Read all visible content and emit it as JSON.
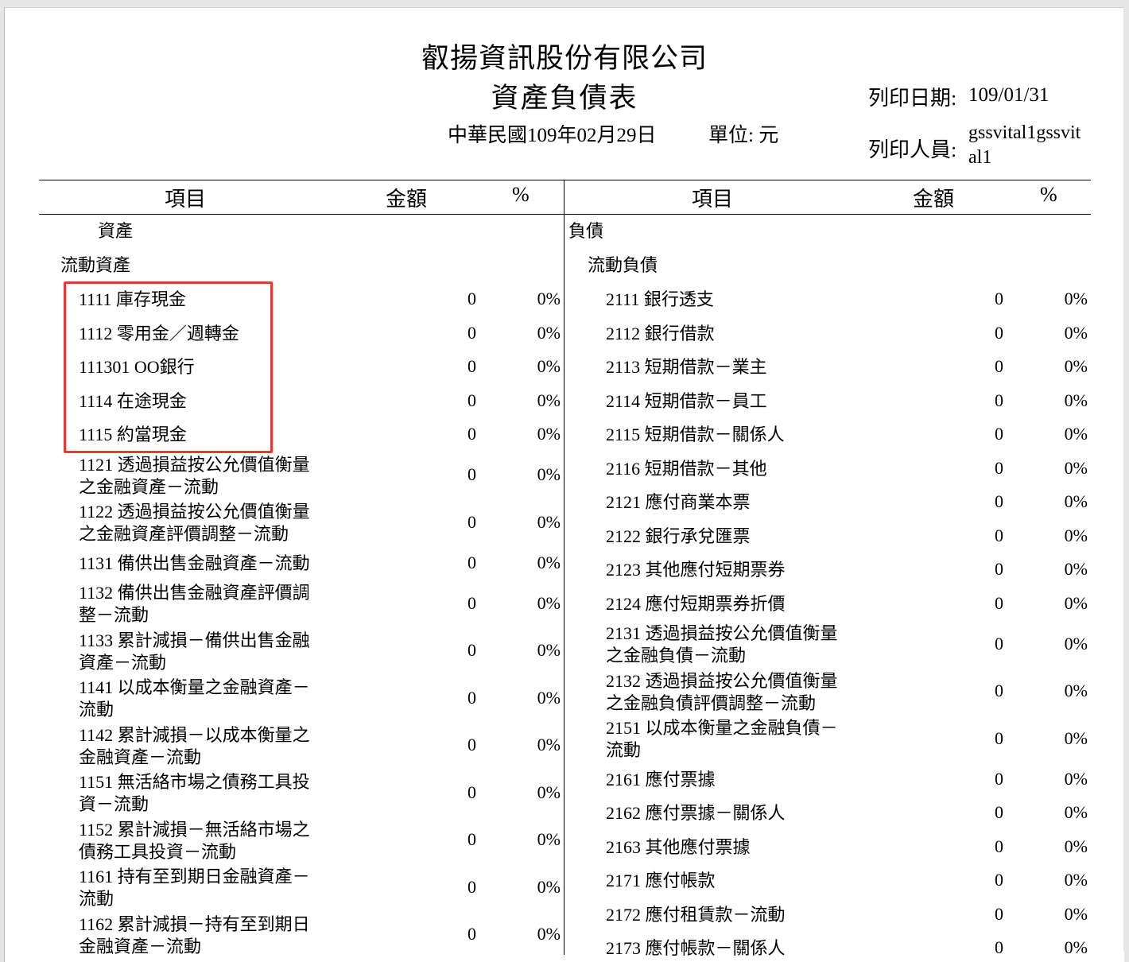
{
  "header": {
    "company": "叡揚資訊股份有限公司",
    "title": "資產負債表",
    "date": "中華民國109年02月29日",
    "unit": "單位: 元",
    "print_date_label": "列印日期:",
    "print_date": "109/01/31",
    "printer_label": "列印人員:",
    "printer": "gssvital1gssvital1"
  },
  "columns": {
    "left": {
      "item": "項目",
      "amount": "金額",
      "pct": "%"
    },
    "right": {
      "item": "項目",
      "amount": "金額",
      "pct": "%"
    }
  },
  "left": {
    "section": "資產",
    "subsection": "流動資產",
    "rows": [
      {
        "lines": [
          "1111 庫存現金"
        ],
        "amount": "0",
        "pct": "0%"
      },
      {
        "lines": [
          "1112 零用金／週轉金"
        ],
        "amount": "0",
        "pct": "0%"
      },
      {
        "lines": [
          "111301 OO銀行"
        ],
        "amount": "0",
        "pct": "0%"
      },
      {
        "lines": [
          "1114 在途現金"
        ],
        "amount": "0",
        "pct": "0%"
      },
      {
        "lines": [
          "1115 約當現金"
        ],
        "amount": "0",
        "pct": "0%"
      },
      {
        "lines": [
          "1121 透過損益按公允價值衡量",
          "之金融資產－流動"
        ],
        "amount": "0",
        "pct": "0%"
      },
      {
        "lines": [
          "1122 透過損益按公允價值衡量",
          "之金融資產評價調整－流動"
        ],
        "amount": "0",
        "pct": "0%"
      },
      {
        "lines": [
          "1131 備供出售金融資產－流動"
        ],
        "amount": "0",
        "pct": "0%"
      },
      {
        "lines": [
          "1132 備供出售金融資產評價調",
          "整－流動"
        ],
        "amount": "0",
        "pct": "0%"
      },
      {
        "lines": [
          "1133 累計減損－備供出售金融",
          "資產－流動"
        ],
        "amount": "0",
        "pct": "0%"
      },
      {
        "lines": [
          "1141 以成本衡量之金融資產－",
          "流動"
        ],
        "amount": "0",
        "pct": "0%"
      },
      {
        "lines": [
          "1142 累計減損－以成本衡量之",
          "金融資產－流動"
        ],
        "amount": "0",
        "pct": "0%"
      },
      {
        "lines": [
          "1151 無活絡市場之債務工具投",
          "資－流動"
        ],
        "amount": "0",
        "pct": "0%"
      },
      {
        "lines": [
          "1152 累計減損－無活絡市場之",
          "債務工具投資－流動"
        ],
        "amount": "0",
        "pct": "0%"
      },
      {
        "lines": [
          "1161 持有至到期日金融資產－",
          "流動"
        ],
        "amount": "0",
        "pct": "0%"
      },
      {
        "lines": [
          "1162 累計減損－持有至到期日",
          "金融資產－流動"
        ],
        "amount": "0",
        "pct": "0%"
      }
    ]
  },
  "right": {
    "section": "負債",
    "subsection": "流動負債",
    "rows": [
      {
        "lines": [
          "2111 銀行透支"
        ],
        "amount": "0",
        "pct": "0%"
      },
      {
        "lines": [
          "2112 銀行借款"
        ],
        "amount": "0",
        "pct": "0%"
      },
      {
        "lines": [
          "2113 短期借款－業主"
        ],
        "amount": "0",
        "pct": "0%"
      },
      {
        "lines": [
          "2114 短期借款－員工"
        ],
        "amount": "0",
        "pct": "0%"
      },
      {
        "lines": [
          "2115 短期借款－關係人"
        ],
        "amount": "0",
        "pct": "0%"
      },
      {
        "lines": [
          "2116 短期借款－其他"
        ],
        "amount": "0",
        "pct": "0%"
      },
      {
        "lines": [
          "2121 應付商業本票"
        ],
        "amount": "0",
        "pct": "0%"
      },
      {
        "lines": [
          "2122 銀行承兌匯票"
        ],
        "amount": "0",
        "pct": "0%"
      },
      {
        "lines": [
          "2123 其他應付短期票券"
        ],
        "amount": "0",
        "pct": "0%"
      },
      {
        "lines": [
          "2124 應付短期票券折價"
        ],
        "amount": "0",
        "pct": "0%"
      },
      {
        "lines": [
          "2131 透過損益按公允價值衡量",
          "之金融負債－流動"
        ],
        "amount": "0",
        "pct": "0%"
      },
      {
        "lines": [
          "2132 透過損益按公允價值衡量",
          "之金融負債評價調整－流動"
        ],
        "amount": "0",
        "pct": "0%"
      },
      {
        "lines": [
          "2151 以成本衡量之金融負債－",
          "流動"
        ],
        "amount": "0",
        "pct": "0%"
      },
      {
        "lines": [
          "2161 應付票據"
        ],
        "amount": "0",
        "pct": "0%"
      },
      {
        "lines": [
          "2162 應付票據－關係人"
        ],
        "amount": "0",
        "pct": "0%"
      },
      {
        "lines": [
          "2163 其他應付票據"
        ],
        "amount": "0",
        "pct": "0%"
      },
      {
        "lines": [
          "2171 應付帳款"
        ],
        "amount": "0",
        "pct": "0%"
      },
      {
        "lines": [
          "2172 應付租賃款－流動"
        ],
        "amount": "0",
        "pct": "0%"
      },
      {
        "lines": [
          "2173 應付帳款－關係人"
        ],
        "amount": "0",
        "pct": "0%"
      }
    ]
  }
}
